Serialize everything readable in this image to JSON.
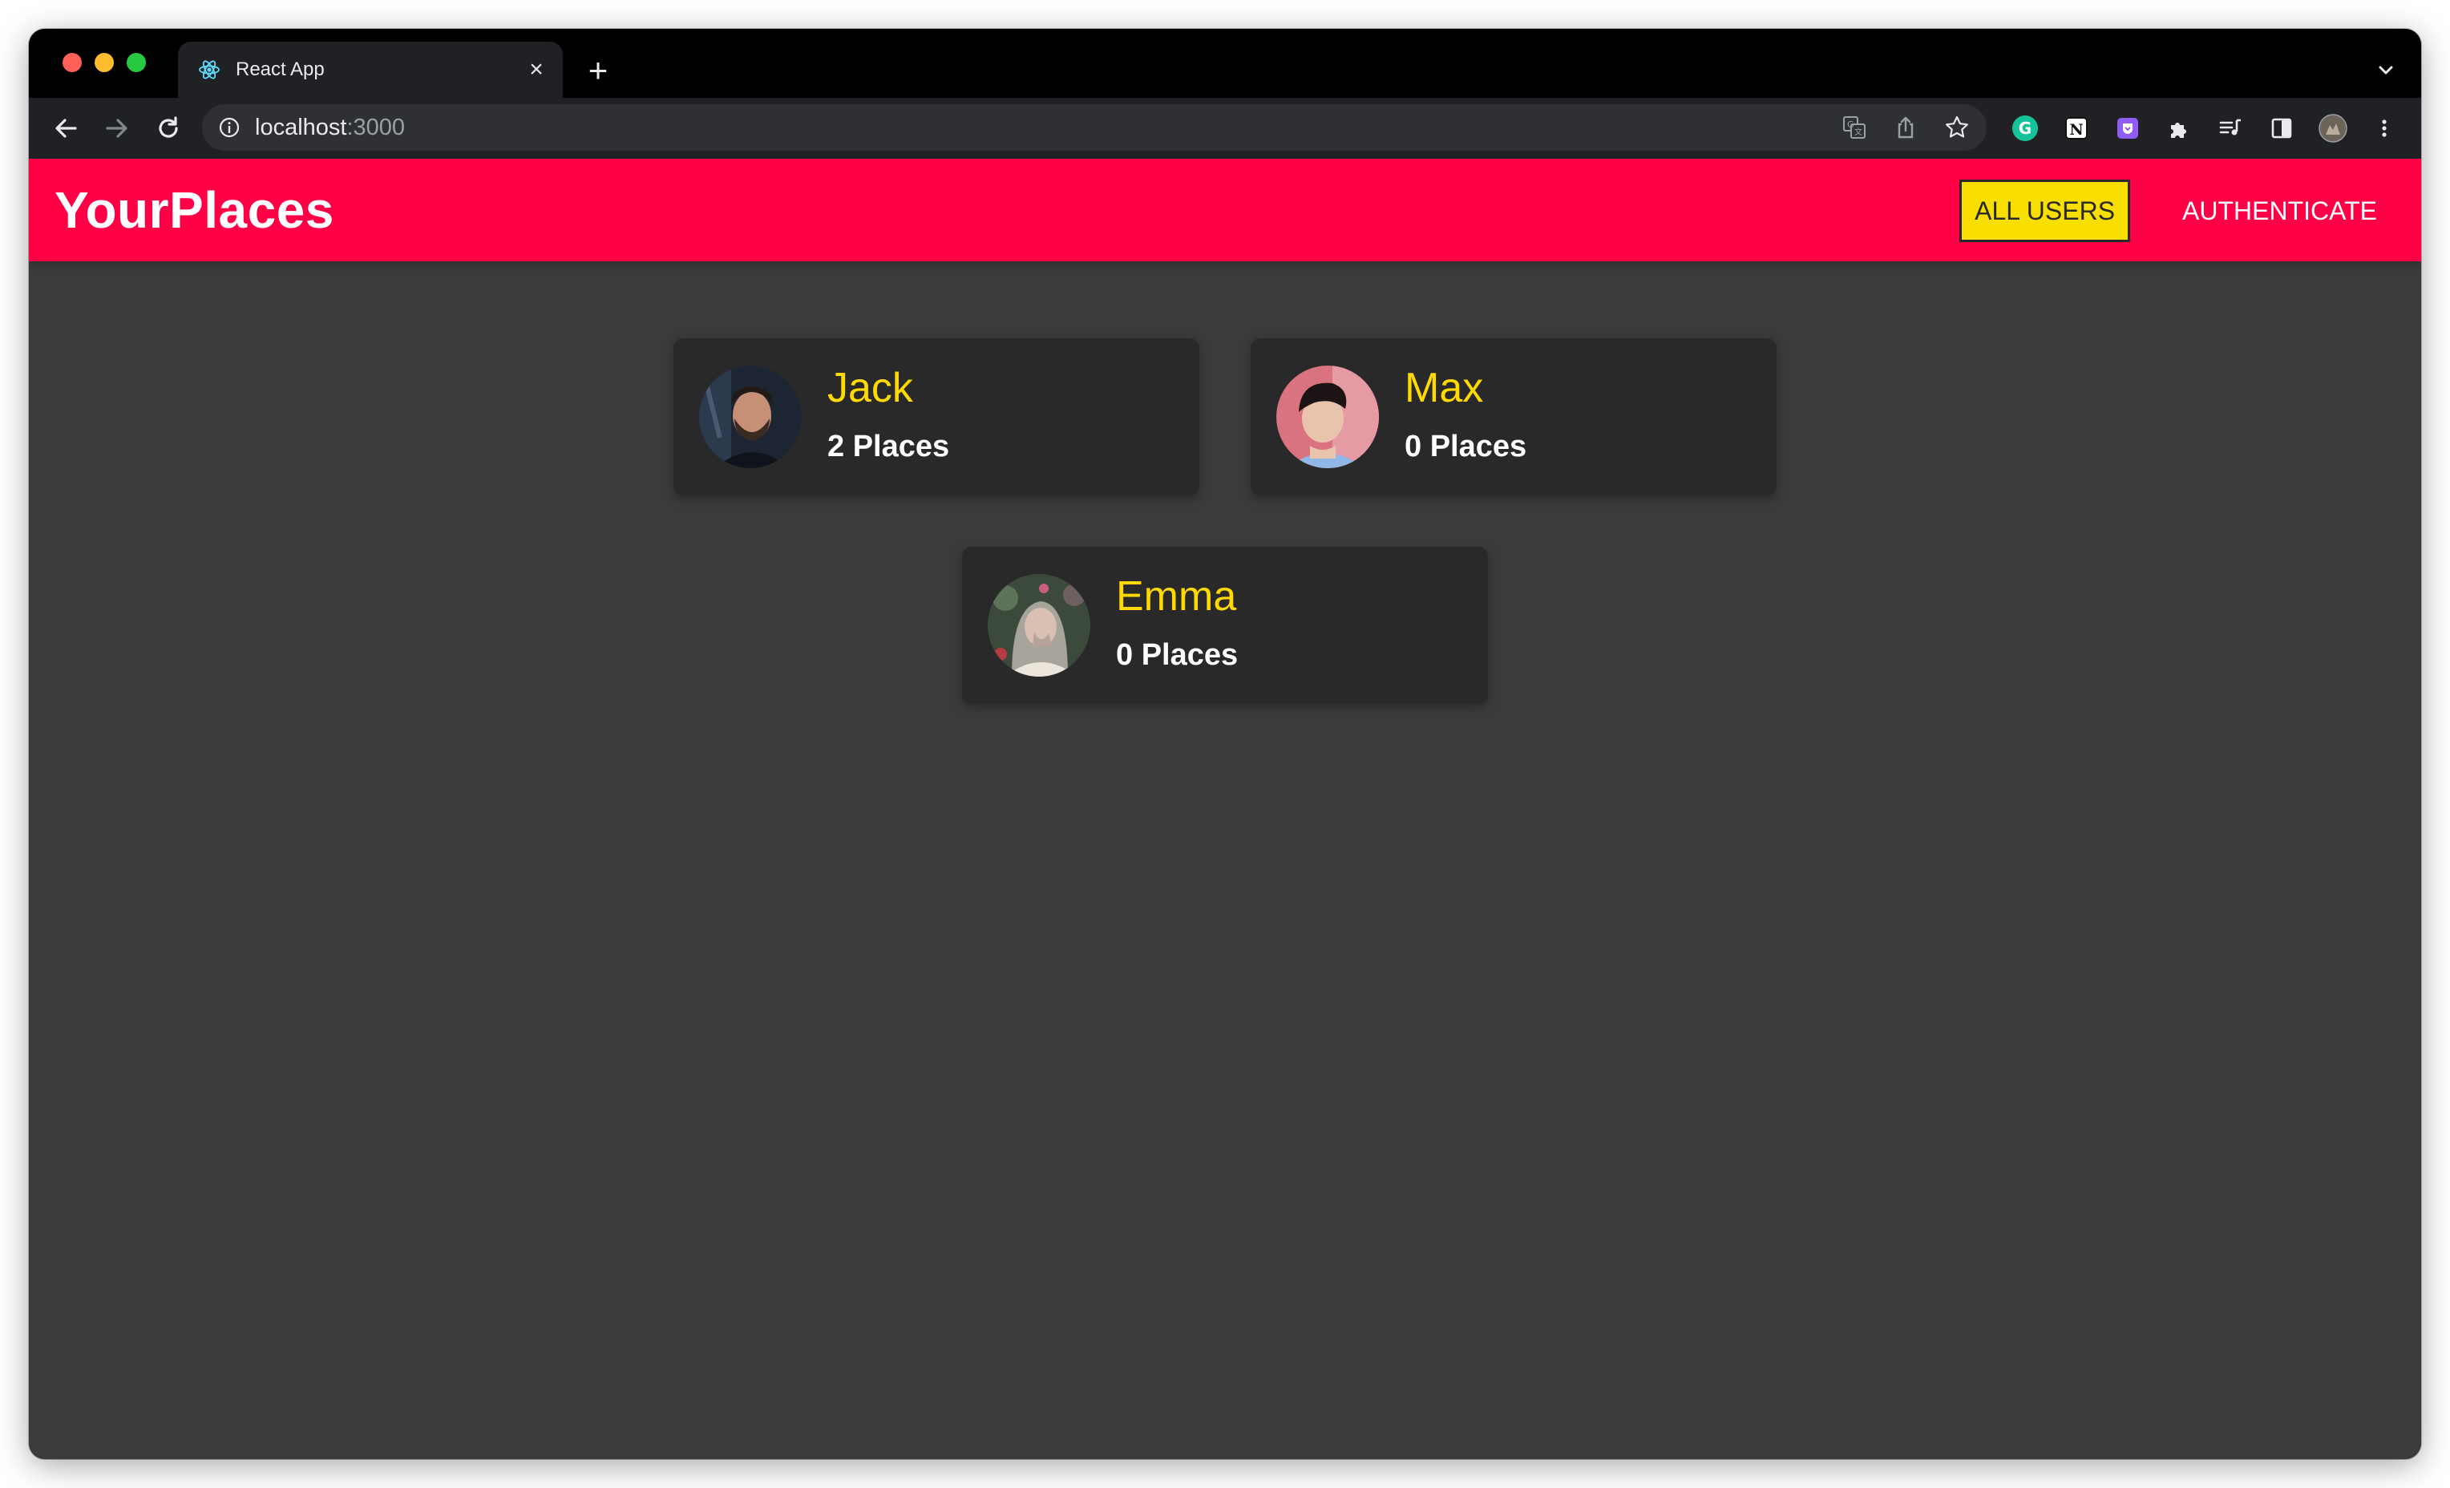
{
  "browser": {
    "tab_title": "React App",
    "url_host": "localhost",
    "url_port": ":3000",
    "icons": [
      "react-favicon",
      "close-icon",
      "plus-icon",
      "chevron-down-icon",
      "back-arrow-icon",
      "forward-arrow-icon",
      "reload-icon",
      "info-icon",
      "translate-icon",
      "share-icon",
      "star-icon",
      "grammarly-icon",
      "notion-icon",
      "extension-shield-icon",
      "puzzle-icon",
      "media-queue-icon",
      "side-panel-icon",
      "profile-avatar-icon",
      "more-vert-icon"
    ]
  },
  "header": {
    "brand": "YourPlaces",
    "nav": [
      {
        "label": "ALL USERS",
        "active": true
      },
      {
        "label": "AUTHENTICATE",
        "active": false
      }
    ],
    "accent_color": "#ff0046",
    "active_color": "#f8df00"
  },
  "users": [
    {
      "name": "Jack",
      "places": "2 Places"
    },
    {
      "name": "Max",
      "places": "0 Places"
    },
    {
      "name": "Emma",
      "places": "0 Places"
    }
  ]
}
